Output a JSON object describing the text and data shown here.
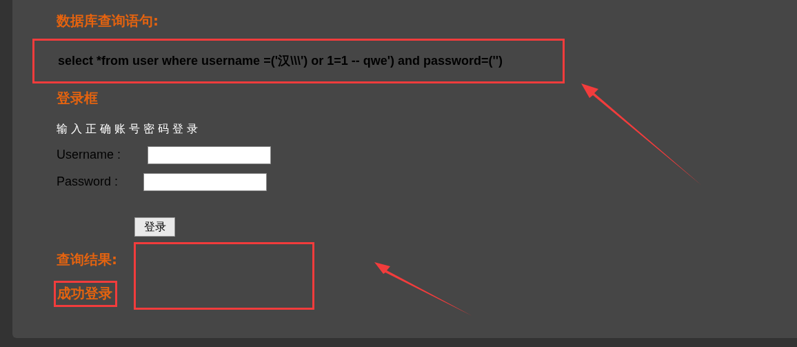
{
  "query_section": {
    "heading": "数据库查询语句:",
    "statement": "select *from user where username =('汉\\\\\\') or 1=1 -- qwe') and password=('')"
  },
  "login_section": {
    "heading": "登录框",
    "instruction": "输入正确账号密码登录",
    "fields": [
      {
        "label": "Username :"
      },
      {
        "label": "Password :"
      }
    ],
    "button": "登录"
  },
  "result_section": {
    "heading": "查询结果:",
    "message": "成功登录"
  }
}
